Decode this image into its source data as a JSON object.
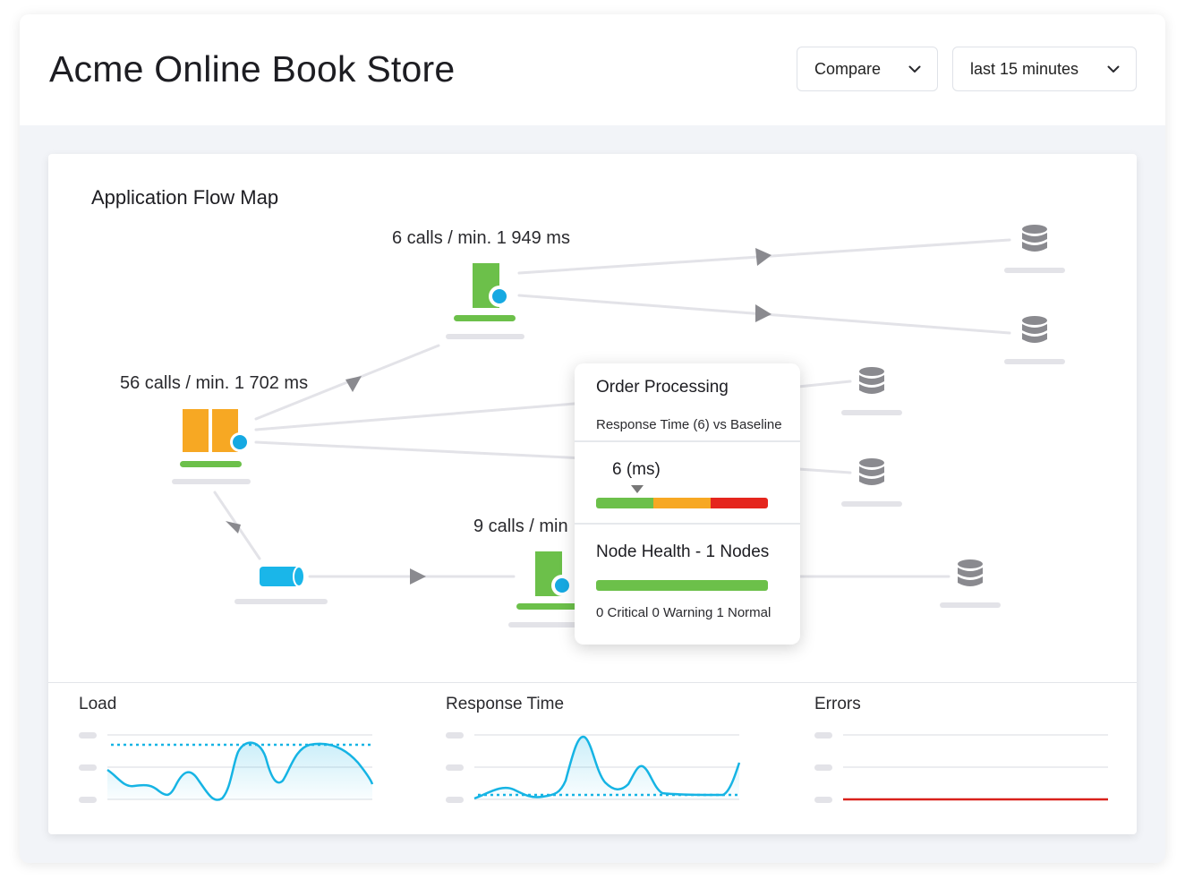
{
  "header": {
    "title": "Acme Online Book Store",
    "compare_label": "Compare",
    "time_range_label": "last 15 minutes"
  },
  "flow_map": {
    "title": "Application Flow Map",
    "nodes": [
      {
        "id": "frontend",
        "type": "application",
        "label": "56 calls / min. 1 702 ms",
        "color": "#f7a823",
        "health_color": "#6cc04a"
      },
      {
        "id": "service-top",
        "type": "service",
        "label": "6 calls / min. 1 949 ms",
        "color": "#6cc04a",
        "health_color": "#6cc04a"
      },
      {
        "id": "service-bottom",
        "type": "service",
        "label": "9 calls / min",
        "color": "#6cc04a",
        "health_color": "#6cc04a"
      },
      {
        "id": "queue",
        "type": "message-queue",
        "label": "",
        "color": "#1ab6e9"
      },
      {
        "id": "db-1",
        "type": "database",
        "label": ""
      },
      {
        "id": "db-2",
        "type": "database",
        "label": ""
      },
      {
        "id": "db-3",
        "type": "database",
        "label": ""
      },
      {
        "id": "db-4",
        "type": "database",
        "label": ""
      },
      {
        "id": "db-5",
        "type": "database",
        "label": ""
      }
    ],
    "colors": {
      "edge": "#e3e3e8",
      "arrow": "#8a8a8f",
      "database": "#8a8a8f",
      "placeholder": "#e3e3e8",
      "status_dot": "#16a9e2"
    }
  },
  "tooltip": {
    "title": "Order Processing",
    "subtitle": "Response Time (6) vs Baseline",
    "value": "6 (ms)",
    "baseline_colors": [
      "#6cc04a",
      "#f7a823",
      "#e5251d"
    ],
    "value_position_pct": 23,
    "health_title": "Node Health - 1 Nodes",
    "health_counts": "0 Critical 0 Warning 1 Normal",
    "health_color": "#6cc04a"
  },
  "metrics": [
    {
      "title": "Load",
      "color": "#16b4e4",
      "threshold": "dotted"
    },
    {
      "title": "Response Time",
      "color": "#16b4e4",
      "threshold": "dotted"
    },
    {
      "title": "Errors",
      "color": "#d9221c",
      "threshold": "none"
    }
  ]
}
